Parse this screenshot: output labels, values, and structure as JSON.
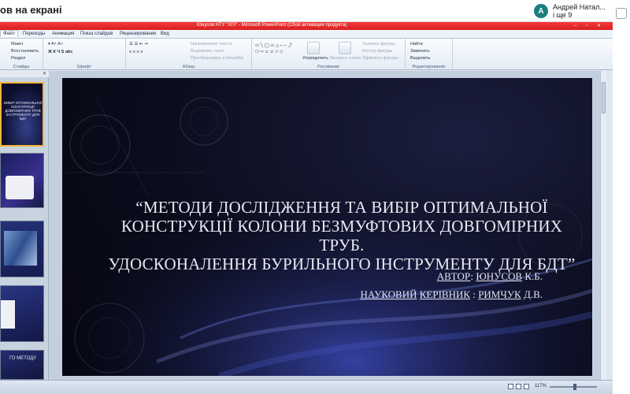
{
  "meet": {
    "title": "ов на екрані",
    "user_name": "Андрей Натал...",
    "user_more": "і ще 9",
    "avatar_letter": "А"
  },
  "ppt": {
    "window_title": "Юнусов НТУ \"ХПІ\" - Microsoft PowerPoint (Сбой активации продукта)",
    "tabs": [
      "Файл",
      "Переходы",
      "Анимация",
      "Показ слайдов",
      "Рецензирование",
      "Вид"
    ],
    "ribbon": {
      "slides_group": {
        "label": "Слайды",
        "layout": "Макет",
        "reset": "Восстановить",
        "section": "Раздел"
      },
      "font_group": {
        "label": "Шрифт"
      },
      "paragraph_group": {
        "label": "Абзац",
        "text_direction": "Направление текста",
        "align_text": "Выровнять текст",
        "smartart": "Преобразовать в SmartArt"
      },
      "drawing_group": {
        "label": "Рисование",
        "arrange": "Упорядочить",
        "quick_styles": "Экспресс-стили",
        "fill": "Заливка фигуры",
        "outline": "Контур фигуры",
        "effects": "Эффекты фигуры"
      },
      "editing_group": {
        "label": "Редактирование",
        "find": "Найти",
        "replace": "Заменить",
        "select": "Выделить"
      }
    },
    "zoom": "117%"
  },
  "slide": {
    "title_line1": "“МЕТОДИ ДОСЛІДЖЕННЯ ТА ВИБІР ОПТИМАЛЬНОЇ",
    "title_line2": "КОНСТРУКЦІЇ КОЛОНИ БЕЗМУФТОВИХ ДОВГОМІРНИХ ТРУБ.",
    "title_line3": "УДОСКОНАЛЕННЯ БУРИЛЬНОГО ІНСТРУМЕНТУ ДЛЯ БДТ”",
    "author_label": "АВТОР",
    "author_sep": ": ",
    "author_name": "ЮНУСОВ",
    "author_initials": " К.Б.",
    "supervisor_word1": "НАУКОВИЙ",
    "supervisor_word2": "КЕРІВНИК",
    "supervisor_sep": " : ",
    "supervisor_name": "РИМЧУК",
    "supervisor_initials": " Д.В."
  },
  "thumbnails": {
    "t1_text": "ВИБІР ОПТИМАЛЬНОЇ КОНСТРУКЦІЇ ДОВГОМІРНИХ ТРУБ ІНСТРУМЕНТУ ДЛЯ БДТ",
    "t5_text": "ГО МЕТОДУ"
  }
}
